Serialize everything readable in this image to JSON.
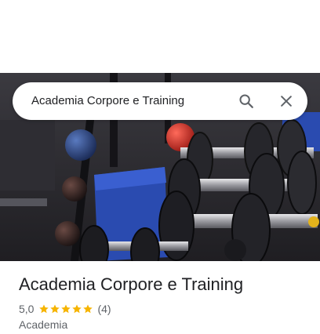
{
  "search": {
    "query": "Academia Corpore e Training",
    "search_icon": "search-icon",
    "close_icon": "close-icon"
  },
  "place": {
    "name": "Academia Corpore e Training",
    "rating": "5,0",
    "stars": 5,
    "review_count": "(4)",
    "category": "Academia"
  },
  "colors": {
    "star": "#f6b400",
    "text_primary": "#202124",
    "text_secondary": "#5f6368"
  }
}
